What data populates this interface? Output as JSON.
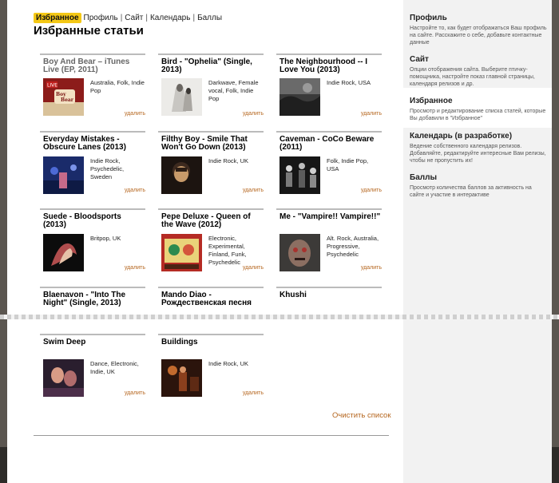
{
  "nav": {
    "active": "Избранное",
    "items": [
      "Профиль",
      "Сайт",
      "Календарь",
      "Баллы"
    ],
    "separator": "|"
  },
  "page_title": "Избранные статьи",
  "remove_label": "удалить",
  "cards": [
    {
      "title": "Boy And Bear – iTunes Live (EP, 2011)",
      "tags": "Australia, Folk, Indie Pop",
      "thumb": "boy-and-bear-cover"
    },
    {
      "title": "Bird - \"Ophelia\" (Single, 2013)",
      "tags": "Darkwave, Female vocal, Folk, Indie Pop",
      "thumb": "bird-cover"
    },
    {
      "title": "The Neighbourhood -- I Love You (2013)",
      "tags": "Indie Rock, USA",
      "thumb": "neighbourhood-cover"
    },
    {
      "title": "Everyday Mistakes - Obscure Lanes (2013)",
      "tags": "Indie Rock, Psychedelic, Sweden",
      "thumb": "everyday-mistakes-cover"
    },
    {
      "title": "Filthy Boy - Smile That Won't Go Down (2013)",
      "tags": "Indie Rock, UK",
      "thumb": "filthy-boy-cover"
    },
    {
      "title": "Caveman - CoCo Beware (2011)",
      "tags": "Folk, Indie Pop, USA",
      "thumb": "caveman-cover"
    },
    {
      "title": "Suede - Bloodsports (2013)",
      "tags": "Britpop, UK",
      "thumb": "suede-cover"
    },
    {
      "title": "Pepe Deluxe - Queen of the Wave (2012)",
      "tags": "Electronic, Experimental, Finland, Funk, Psychedelic",
      "thumb": "pepe-deluxe-cover"
    },
    {
      "title": "Me - \"Vampire!! Vampire!!\"",
      "tags": "Alt. Rock, Australia, Progressive, Psychedelic",
      "thumb": "me-cover"
    },
    {
      "title": "Blaenavon - \"Into The Night\" (Single, 2013)",
      "tags": "",
      "thumb": ""
    },
    {
      "title": "Mando Diao - Рождественская песня",
      "tags": "",
      "thumb": ""
    },
    {
      "title": "Khushi",
      "tags": "",
      "thumb": ""
    },
    {
      "title": "Swim Deep",
      "tags": "Dance, Electronic, Indie, UK",
      "thumb": "swim-deep-cover"
    },
    {
      "title": "Buildings",
      "tags": "Indie Rock, UK",
      "thumb": "buildings-cover"
    }
  ],
  "clear_list": "Очистить список",
  "sidebar": {
    "items": [
      {
        "title": "Профиль",
        "text": "Настройте то, как будет отображаться Ваш профиль на сайте. Расскажите о себе, добавьте контактные данные"
      },
      {
        "title": "Сайт",
        "text": "Опции отображения сайта. Выберите птичку-помощника, настройте показ главной страницы, календаря релизов и др."
      },
      {
        "title": "Избранное",
        "text": "Просмотр и редактирование списка статей, которые Вы добавили в \"Избранное\""
      },
      {
        "title": "Календарь (в разработке)",
        "text": "Ведение собственного календаря релизов. Добавляйте, редактируйте интересные Вам релизы, чтобы не пропустить их!"
      },
      {
        "title": "Баллы",
        "text": "Просмотр количества баллов за активность на сайте и участие в интерактиве"
      }
    ]
  },
  "colors": {
    "accent": "#f4c816",
    "link": "#b5651d",
    "sidebar_bg": "#f2f2f2"
  }
}
